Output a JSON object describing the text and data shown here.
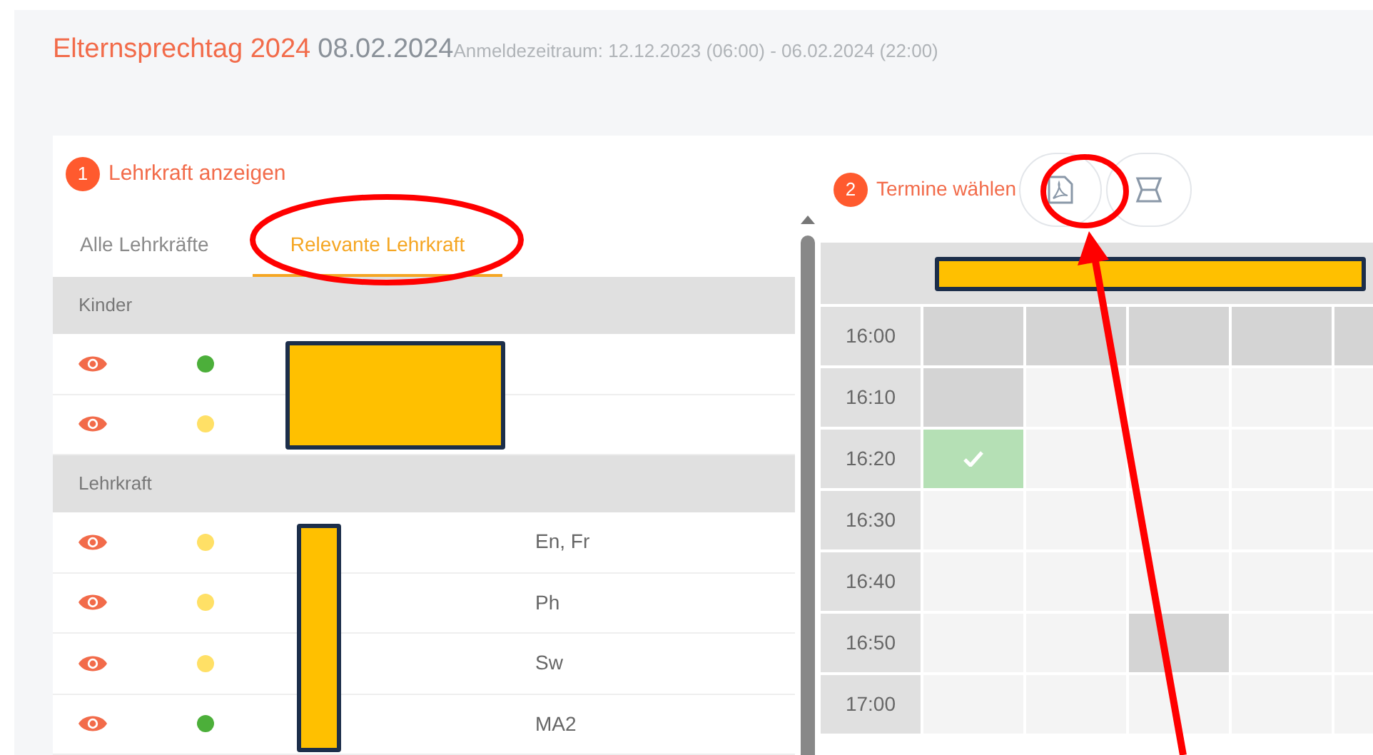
{
  "header": {
    "title": "Elternsprechtag 2024",
    "date": "08.02.2024",
    "period": "Anmeldezeitraum: 12.12.2023 (06:00) - 06.02.2024 (22:00)"
  },
  "teacher_panel": {
    "step": "1",
    "heading": "Lehrkraft anzeigen",
    "tabs": [
      {
        "label": "Alle Lehrkräfte",
        "selected": false
      },
      {
        "label": "Relevante Lehrkraft",
        "selected": true
      }
    ],
    "groups": [
      {
        "title": "Kinder",
        "rows": [
          {
            "color": "#4caf3a"
          },
          {
            "color": "#ffe066"
          }
        ]
      },
      {
        "title": "Lehrkraft",
        "rows": [
          {
            "color": "#ffe066",
            "subject": "En, Fr"
          },
          {
            "color": "#ffe066",
            "subject": "Ph"
          },
          {
            "color": "#ffe066",
            "subject": "Sw"
          },
          {
            "color": "#4caf3a",
            "subject": "MA2"
          }
        ]
      }
    ]
  },
  "schedule_panel": {
    "step": "2",
    "heading": "Termine wählen",
    "rows": [
      {
        "time": "16:00",
        "cells": [
          {
            "kind": "blocked"
          },
          {
            "kind": "blocked"
          },
          {
            "kind": "blocked"
          },
          {
            "kind": "blocked"
          },
          {
            "kind": "blocked"
          }
        ]
      },
      {
        "time": "16:10",
        "cells": [
          {
            "kind": "blocked"
          },
          {
            "kind": "free"
          },
          {
            "kind": "free"
          },
          {
            "kind": "free"
          },
          {
            "kind": "free"
          }
        ]
      },
      {
        "time": "16:20",
        "cells": [
          {
            "kind": "booked"
          },
          {
            "kind": "free"
          },
          {
            "kind": "free"
          },
          {
            "kind": "free"
          },
          {
            "kind": "free"
          }
        ]
      },
      {
        "time": "16:30",
        "cells": [
          {
            "kind": "free"
          },
          {
            "kind": "free"
          },
          {
            "kind": "free"
          },
          {
            "kind": "free"
          },
          {
            "kind": "free"
          }
        ]
      },
      {
        "time": "16:40",
        "cells": [
          {
            "kind": "free"
          },
          {
            "kind": "free"
          },
          {
            "kind": "free"
          },
          {
            "kind": "free"
          },
          {
            "kind": "free"
          }
        ]
      },
      {
        "time": "16:50",
        "cells": [
          {
            "kind": "free"
          },
          {
            "kind": "free"
          },
          {
            "kind": "blocked"
          },
          {
            "kind": "free"
          },
          {
            "kind": "free"
          }
        ]
      },
      {
        "time": "17:00",
        "cells": [
          {
            "kind": "free"
          },
          {
            "kind": "free"
          },
          {
            "kind": "free"
          },
          {
            "kind": "free"
          },
          {
            "kind": "free"
          }
        ]
      }
    ]
  }
}
